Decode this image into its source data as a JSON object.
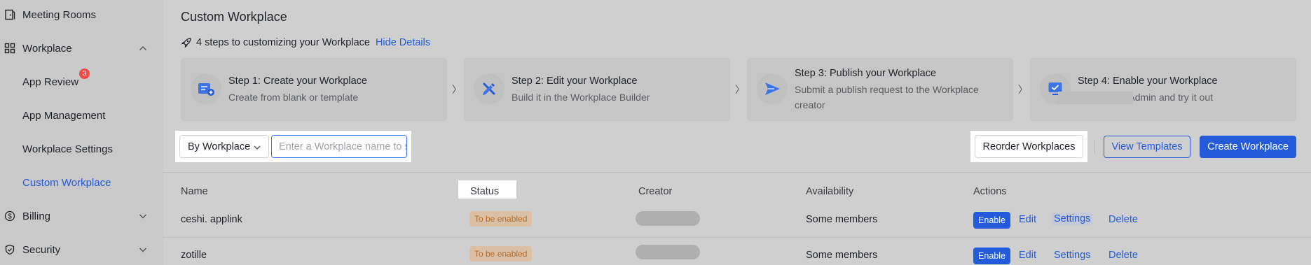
{
  "sidebar": {
    "items": [
      {
        "label": "Meeting Rooms",
        "icon": "door-icon"
      },
      {
        "label": "Workplace",
        "icon": "grid-icon",
        "expanded": true
      },
      {
        "label": "App Review",
        "badge": "3"
      },
      {
        "label": "App Management"
      },
      {
        "label": "Workplace Settings"
      },
      {
        "label": "Custom Workplace",
        "active": true
      },
      {
        "label": "Billing",
        "icon": "dollar-icon"
      },
      {
        "label": "Security",
        "icon": "shield-icon"
      }
    ]
  },
  "main": {
    "title": "Custom Workplace",
    "steps_hint": "4 steps to customizing your Workplace",
    "hide_details": "Hide Details",
    "steps": [
      {
        "title": "Step 1: Create your Workplace",
        "desc": "Create from blank or template"
      },
      {
        "title": "Step 2: Edit your Workplace",
        "desc": "Build it in the Workplace Builder"
      },
      {
        "title": "Step 3: Publish your Workplace",
        "desc1": "Submit a publish request to the Workplace",
        "desc2": "creator"
      },
      {
        "title": "Step 4: Enable your Workplace",
        "desc": "Enable it in Admin and try it out"
      }
    ],
    "step_separator": "〉"
  },
  "filters": {
    "by_value": "By Workplace",
    "search_placeholder": "Enter a Workplace name to sea..."
  },
  "toolbar": {
    "reorder": "Reorder Workplaces",
    "view_templates": "View Templates",
    "create": "Create Workplace"
  },
  "table": {
    "headers": [
      "Name",
      "Status",
      "Creator",
      "Availability",
      "Actions"
    ],
    "rows": [
      {
        "name": "ceshi. applink",
        "status": "To be enabled",
        "availability": "Some members",
        "enable": "Enable",
        "edit": "Edit",
        "settings": "Settings",
        "delete": "Delete"
      },
      {
        "name": "zotille",
        "status": "To be enabled",
        "availability": "Some members",
        "enable": "Enable",
        "edit": "Edit",
        "settings": "Settings",
        "delete": "Delete"
      }
    ]
  },
  "colors": {
    "accent": "#245bdb",
    "badge": "#f54a45",
    "status_tag_bg": "#dcc0a6",
    "status_tag_text": "#b06a2c"
  }
}
